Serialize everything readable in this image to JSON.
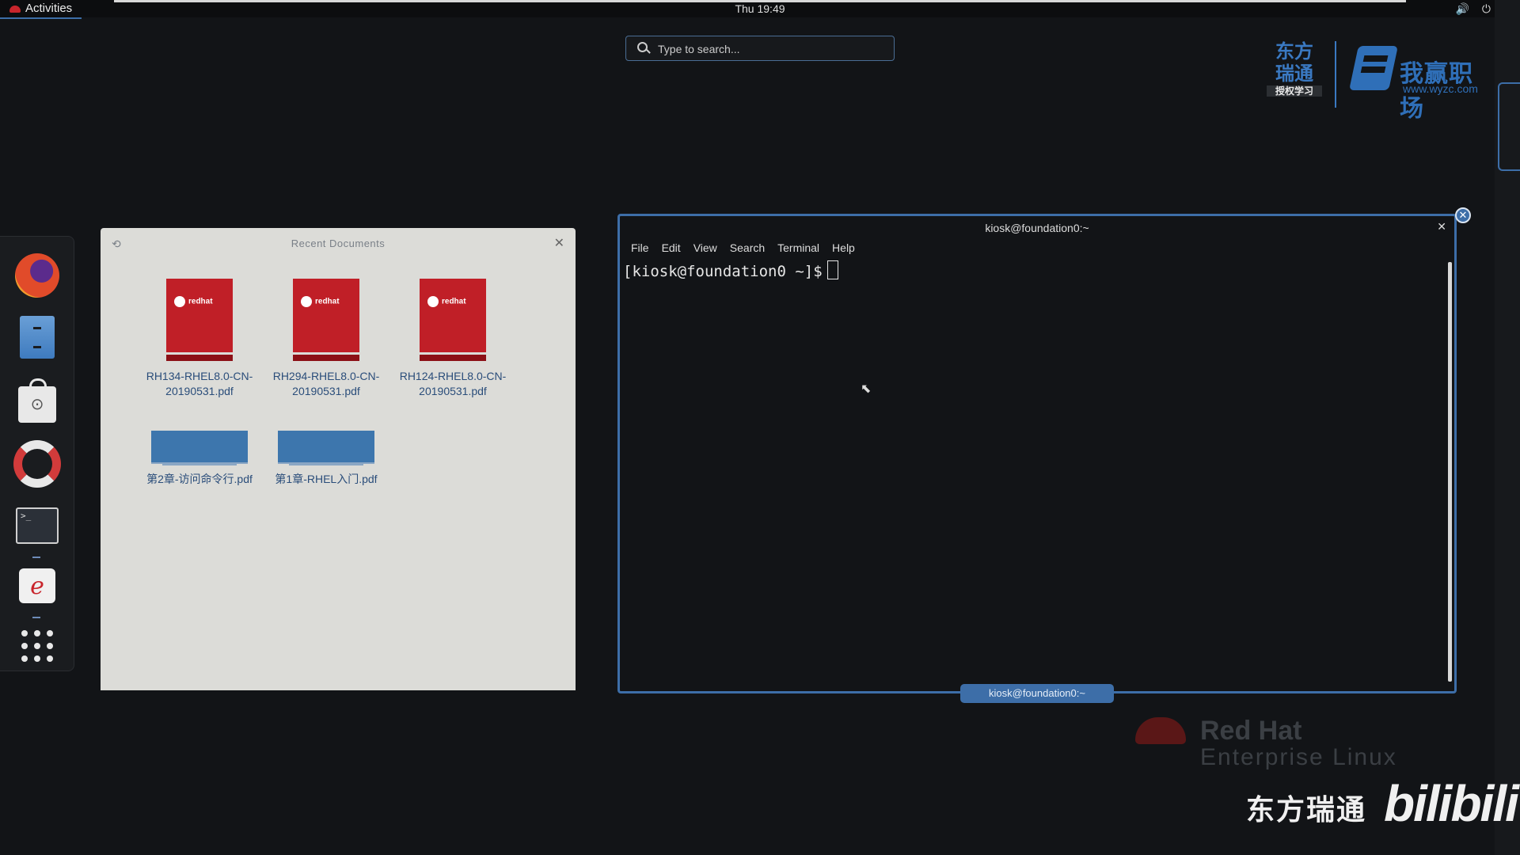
{
  "top_bar": {
    "activities_label": "Activities",
    "clock": "Thu 19:49",
    "icons": [
      "volume-icon",
      "power-icon",
      "dropdown-arrow-icon"
    ]
  },
  "search": {
    "placeholder": "Type to search..."
  },
  "logos": {
    "left_brand": "东方瑞通",
    "left_brand_sub": "授权学习",
    "right_brand": "我赢职场",
    "right_brand_url": "www.wyzc.com"
  },
  "dash": {
    "items": [
      "firefox-icon",
      "files-icon",
      "software-icon",
      "help-icon",
      "terminal-icon",
      "redhat-app-icon",
      "show-applications-icon"
    ]
  },
  "recent_documents": {
    "title": "Recent Documents",
    "documents": [
      {
        "name": "RH134-RHEL8.0-CN-20190531.pdf",
        "thumb": "redhat"
      },
      {
        "name": "RH294-RHEL8.0-CN-20190531.pdf",
        "thumb": "redhat"
      },
      {
        "name": "RH124-RHEL8.0-CN-20190531.pdf",
        "thumb": "redhat"
      },
      {
        "name": "第2章-访问命令行.pdf",
        "thumb": "blue"
      },
      {
        "name": "第1章-RHEL入门.pdf",
        "thumb": "blue"
      }
    ],
    "thumb_text": "redhat"
  },
  "terminal": {
    "title": "kiosk@foundation0:~",
    "menu": [
      "File",
      "Edit",
      "View",
      "Search",
      "Terminal",
      "Help"
    ],
    "prompt": "[kiosk@foundation0 ~]$",
    "caption": "kiosk@foundation0:~"
  },
  "watermarks": {
    "redhat_line1": "Red Hat",
    "redhat_line2": "Enterprise Linux",
    "bili_cn": "东方瑞通",
    "bili_en": "bilibili"
  },
  "colors": {
    "background": "#121417",
    "accent": "#3d6ea8",
    "redhat_red": "#c01f27"
  }
}
